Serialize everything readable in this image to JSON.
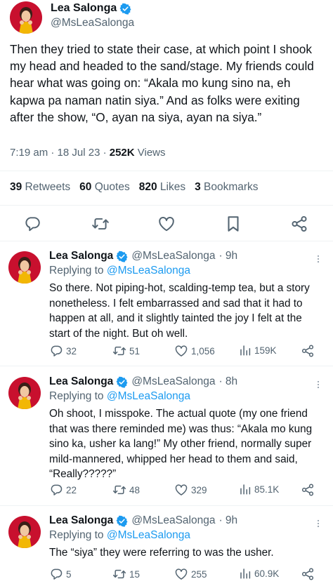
{
  "main_tweet": {
    "author_name": "Lea Salonga",
    "handle": "@MsLeaSalonga",
    "text": "Then they tried to state their case, at which point I shook my head and headed to the sand/stage. My friends could hear what was going on: “Akala mo kung sino na, eh kapwa pa naman natin siya.” And as folks were exiting after the show, “O, ayan na siya, ayan na siya.”",
    "time": "7:19 am · 18 Jul 23 · ",
    "views_count": "252K",
    "views_label": " Views",
    "retweets_count": "39",
    "retweets_label": " Retweets",
    "quotes_count": "60",
    "quotes_label": " Quotes",
    "likes_count": "820",
    "likes_label": " Likes",
    "bookmarks_count": "3",
    "bookmarks_label": " Bookmarks"
  },
  "replies": [
    {
      "author_name": "Lea Salonga",
      "handle": "@MsLeaSalonga",
      "time": "· 9h",
      "replying_prefix": "Replying to ",
      "replying_to": "@MsLeaSalonga",
      "text": "So there. Not piping-hot, scalding-temp tea, but a story nonetheless. I felt embarrassed and sad that it had to happen at all, and it slightly tainted the joy I felt at the start of the night. But oh well.",
      "replies": "32",
      "retweets": "51",
      "likes": "1,056",
      "views": "159K"
    },
    {
      "author_name": "Lea Salonga",
      "handle": "@MsLeaSalonga",
      "time": "· 8h",
      "replying_prefix": "Replying to ",
      "replying_to": "@MsLeaSalonga",
      "text": "Oh shoot, I misspoke. The actual quote (my one friend that was there reminded me) was thus: “Akala mo kung sino ka, usher ka lang!” My other friend, normally super mild-mannered, whipped her head to them and said, “Really?????”",
      "replies": "22",
      "retweets": "48",
      "likes": "329",
      "views": "85.1K"
    },
    {
      "author_name": "Lea Salonga",
      "handle": "@MsLeaSalonga",
      "time": "· 9h",
      "replying_prefix": "Replying to ",
      "replying_to": "@MsLeaSalonga",
      "text": "The “siya” they were referring to was the usher.",
      "replies": "5",
      "retweets": "15",
      "likes": "255",
      "views": "60.9K"
    }
  ],
  "icons": {
    "verified": "verified-badge-icon",
    "reply": "reply-icon",
    "retweet": "retweet-icon",
    "like": "heart-icon",
    "bookmark": "bookmark-icon",
    "share": "share-icon",
    "views": "views-icon",
    "more": "more-icon"
  },
  "colors": {
    "accent": "#1d9bf0",
    "secondary_text": "#536471",
    "avatar_bg": "#c8102e"
  }
}
